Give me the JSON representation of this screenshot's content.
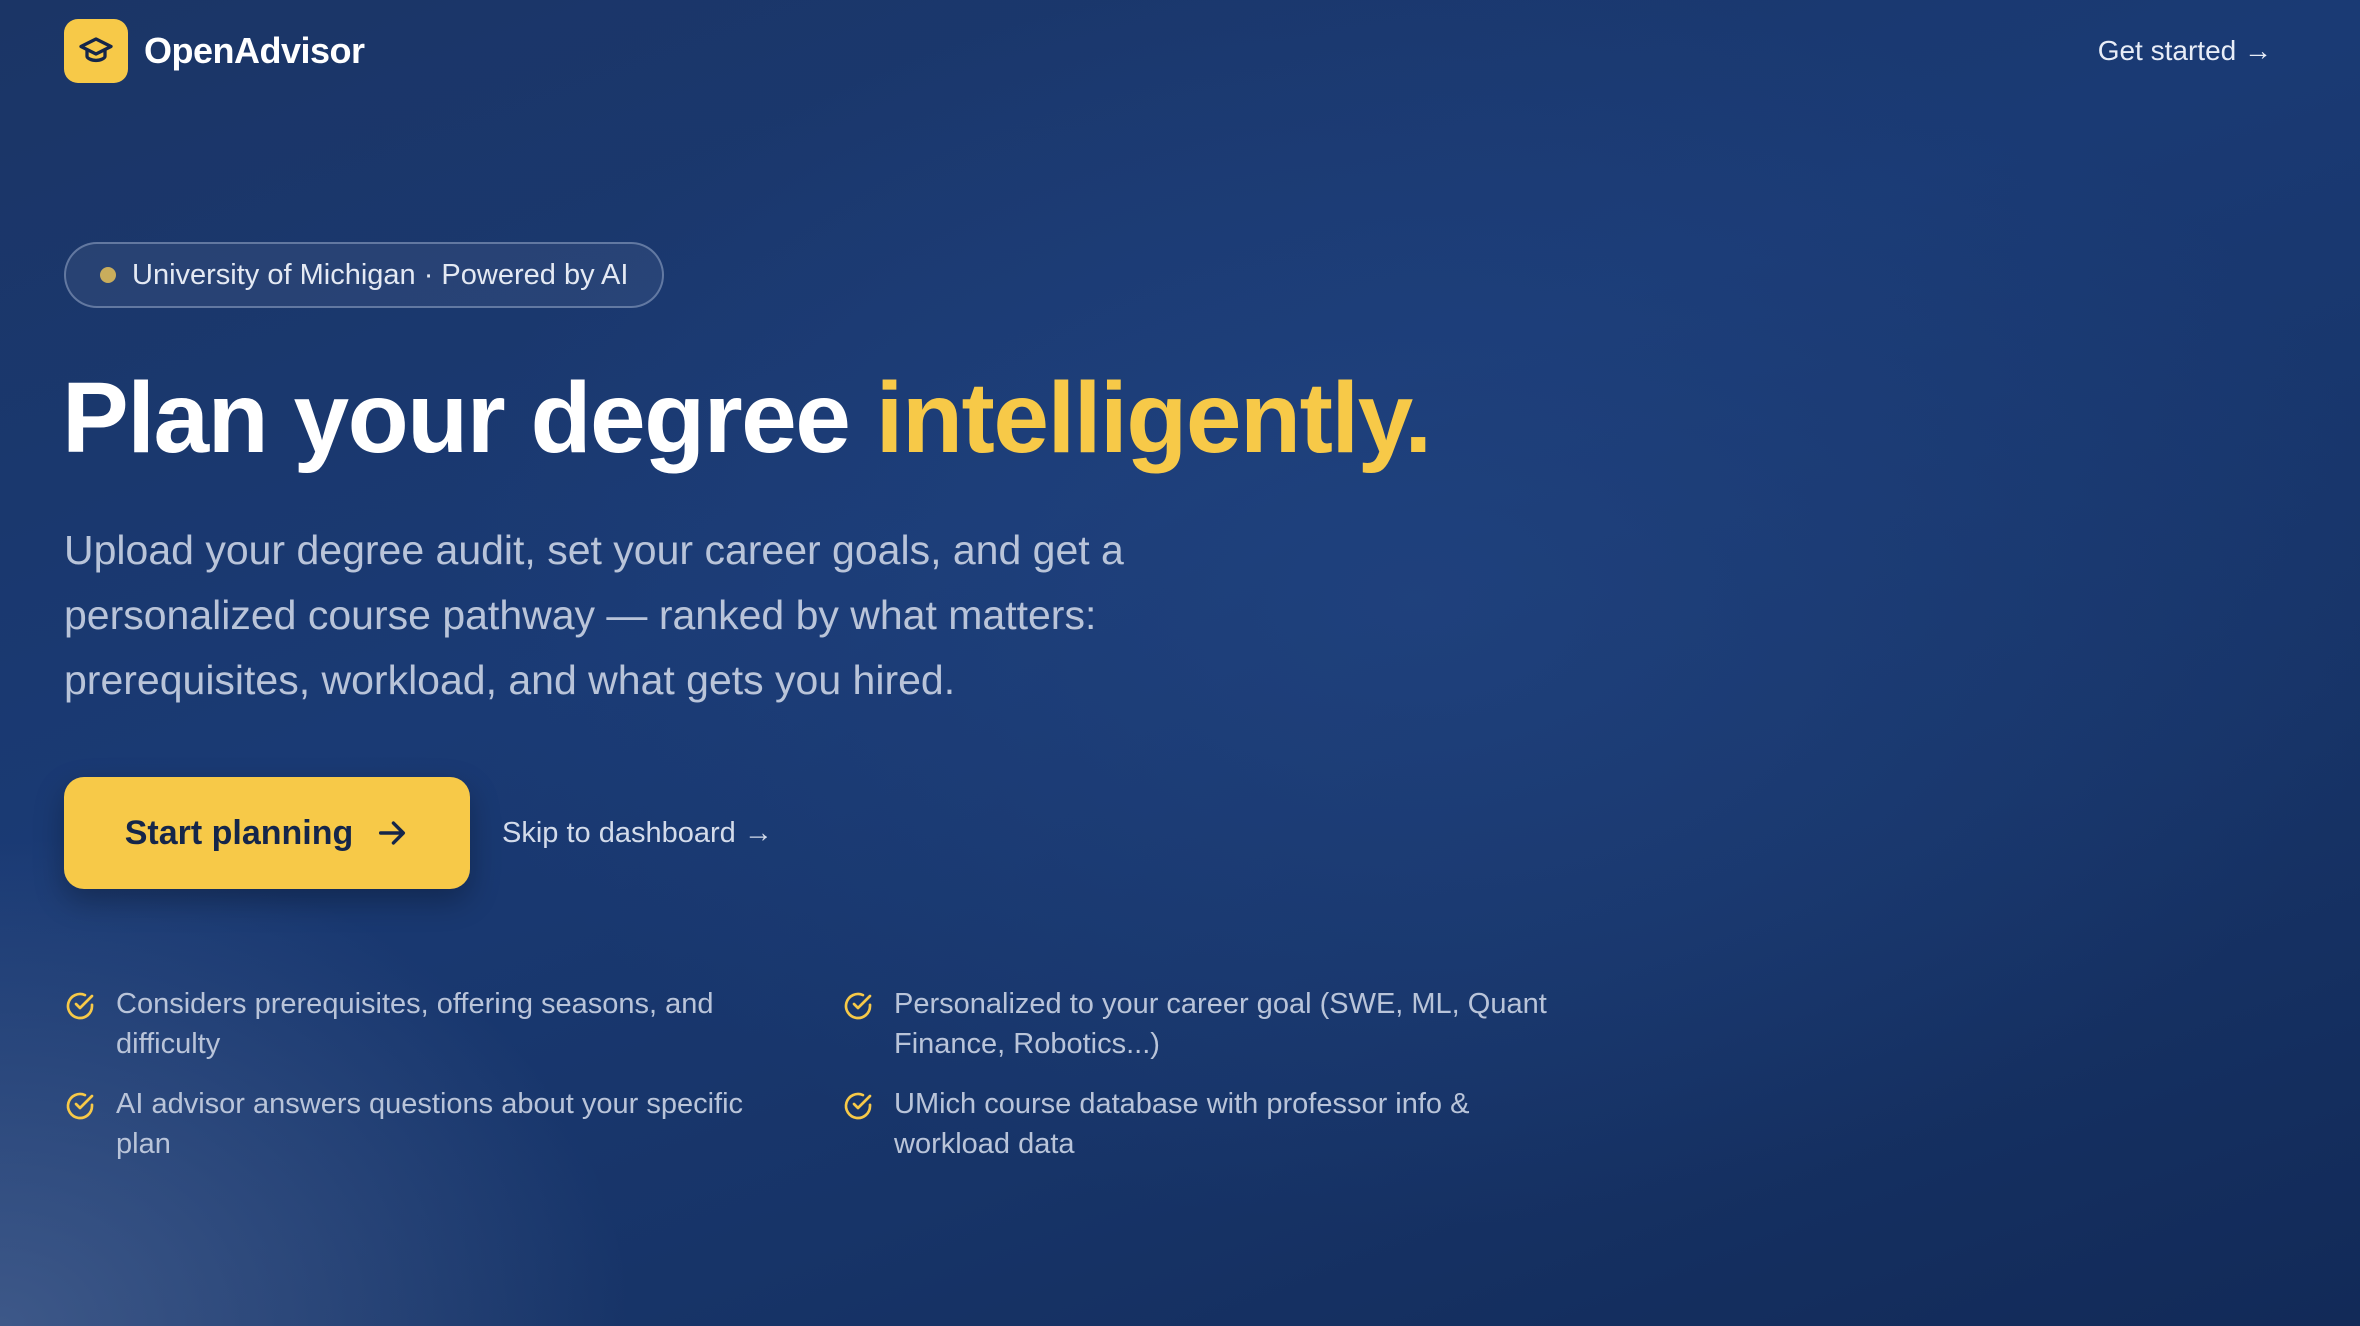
{
  "brand": {
    "name": "OpenAdvisor",
    "logo_icon": "graduation-cap-icon",
    "accent_color": "#f7c948"
  },
  "nav": {
    "cta_label": "Get started →"
  },
  "hero": {
    "badge_text": "University of Michigan · Powered by AI",
    "headline_main": "Plan your degree ",
    "headline_accent": "intelligently.",
    "subtitle": "Upload your degree audit, set your career goals, and get a personalized course pathway — ranked by what matters: prerequisites, workload, and what gets you hired.",
    "primary_button_label": "Start planning",
    "primary_button_icon": "arrow-right-icon",
    "secondary_link_label": "Skip to dashboard →"
  },
  "features": [
    {
      "icon": "check-circle-icon",
      "text": "Considers prerequisites, offering seasons, and difficulty"
    },
    {
      "icon": "check-circle-icon",
      "text": "Personalized to your career goal (SWE, ML, Quant Finance, Robotics...)"
    },
    {
      "icon": "check-circle-icon",
      "text": "AI advisor answers questions about your specific plan"
    },
    {
      "icon": "check-circle-icon",
      "text": "UMich course database with professor info & workload data"
    }
  ]
}
